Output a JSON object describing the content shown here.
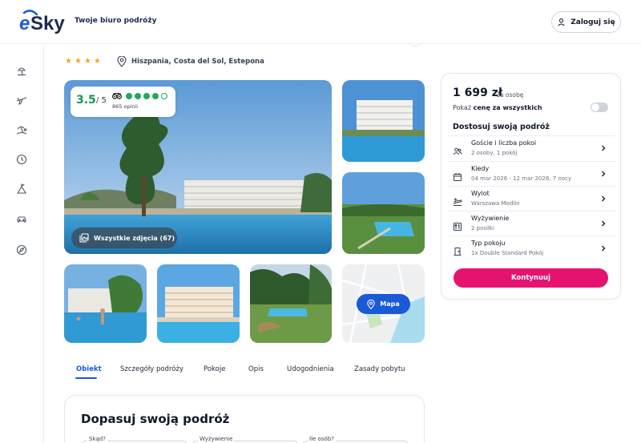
{
  "header": {
    "tagline": "Twoje biuro podróży",
    "login_label": "Zaloguj się"
  },
  "sidebar": {
    "items": [
      {
        "icon": "beach-umbrella-icon"
      },
      {
        "icon": "plane-icon"
      },
      {
        "icon": "island-icon"
      },
      {
        "icon": "clock-icon"
      },
      {
        "icon": "mountain-ski-icon"
      },
      {
        "icon": "car-icon"
      },
      {
        "icon": "compass-icon"
      }
    ]
  },
  "hotel": {
    "stars": 4,
    "location": "Hiszpania, Costa del Sol, Estepona"
  },
  "rating": {
    "score": "3.5",
    "max": "/ 5",
    "bubbles_filled": 4,
    "bubbles_total": 5,
    "reviews": "865 opinii"
  },
  "gallery": {
    "all_photos_label": "Wszystkie zdjęcia (67)",
    "map_label": "Mapa"
  },
  "tabs": [
    "Obiekt",
    "Szczegóły podróży",
    "Pokoje",
    "Opis",
    "Udogodnienia",
    "Zasady pobytu"
  ],
  "active_tab": "Obiekt",
  "adjust": {
    "title": "Dopasuj swoją podróż",
    "fields": [
      "Skąd?",
      "Wyżywienie",
      "Ile osób?"
    ]
  },
  "panel": {
    "price": "1 699 zł",
    "price_unit": "za osobę",
    "show_total_prefix": "Pokaż",
    "show_total_bold": "cenę za wszystkich",
    "title": "Dostosuj swoją podróż",
    "options": [
      {
        "icon": "guests-icon",
        "label": "Goście i liczba pokoi",
        "value": "2 osoby, 1 pokój"
      },
      {
        "icon": "calendar-icon",
        "label": "Kiedy",
        "value": "04 mar 2026 - 12 mar 2026, 7 nocy"
      },
      {
        "icon": "departure-icon",
        "label": "Wylot",
        "value": "Warszawa Modlin"
      },
      {
        "icon": "meal-icon",
        "label": "Wyżywienie",
        "value": "2 posiłki"
      },
      {
        "icon": "room-door-icon",
        "label": "Typ pokoju",
        "value": "1x Double Standard Pokój"
      }
    ],
    "continue_label": "Kontynuuj"
  },
  "colors": {
    "brand_blue": "#1a5ad7",
    "cta_pink": "#e5136f",
    "rating_green": "#22a75e",
    "star_orange": "#f6a623"
  }
}
